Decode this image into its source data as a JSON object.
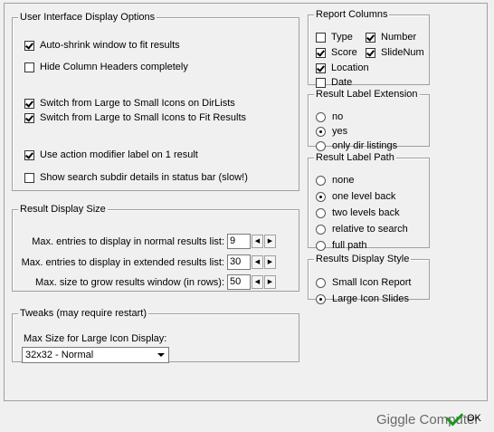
{
  "ui_display": {
    "legend": "User Interface Display Options",
    "options": [
      {
        "label": "Auto-shrink window to fit results",
        "checked": true
      },
      {
        "label": "Hide Column Headers completely",
        "checked": false
      },
      {
        "label": "Switch from Large to Small Icons on DirLists",
        "checked": true
      },
      {
        "label": "Switch from Large to Small Icons to Fit Results",
        "checked": true
      },
      {
        "label": "Use action modifier label on 1 result",
        "checked": true
      },
      {
        "label": "Show search subdir details in status bar (slow!)",
        "checked": false
      }
    ]
  },
  "result_size": {
    "legend": "Result Display Size",
    "rows": [
      {
        "label": "Max. entries to display in normal results list:",
        "value": "9"
      },
      {
        "label": "Max. entries to display in extended results list:",
        "value": "30"
      },
      {
        "label": "Max. size to grow results window (in rows):",
        "value": "50"
      }
    ]
  },
  "tweaks": {
    "legend": "Tweaks (may require restart)",
    "label": "Max Size for Large Icon Display:",
    "selected": "32x32 - Normal"
  },
  "report_columns": {
    "legend": "Report Columns",
    "items": [
      {
        "label": "Type",
        "checked": false
      },
      {
        "label": "Number",
        "checked": true
      },
      {
        "label": "Score",
        "checked": true
      },
      {
        "label": "SlideNum",
        "checked": true
      },
      {
        "label": "Location",
        "checked": true
      },
      {
        "label": "Date",
        "checked": false
      }
    ]
  },
  "label_extension": {
    "legend": "Result Label Extension",
    "options": [
      {
        "label": "no",
        "selected": false
      },
      {
        "label": "yes",
        "selected": true
      },
      {
        "label": "only dir listings",
        "selected": false
      }
    ]
  },
  "label_path": {
    "legend": "Result Label Path",
    "options": [
      {
        "label": "none",
        "selected": false
      },
      {
        "label": "one level back",
        "selected": true
      },
      {
        "label": "two levels back",
        "selected": false
      },
      {
        "label": "relative to search",
        "selected": false
      },
      {
        "label": "full path",
        "selected": false
      }
    ]
  },
  "display_style": {
    "legend": "Results Display Style",
    "options": [
      {
        "label": "Small Icon Report",
        "selected": false
      },
      {
        "label": "Large Icon Slides",
        "selected": true
      }
    ]
  },
  "footer": {
    "brand": "Giggle Computer",
    "ok_label": "OK"
  }
}
